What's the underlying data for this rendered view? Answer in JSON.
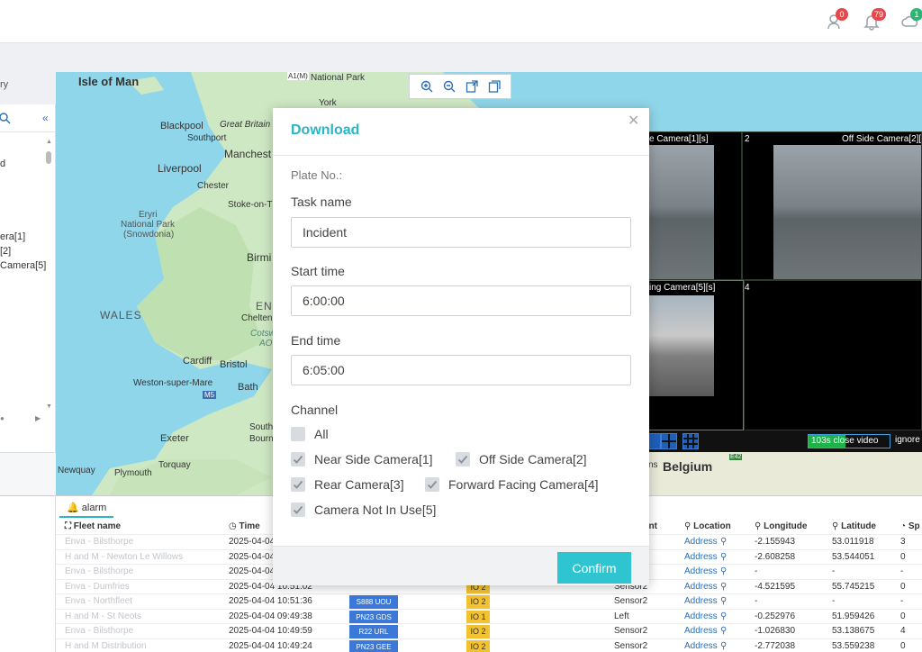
{
  "header": {
    "badges": [
      {
        "icon": "user-alert-icon",
        "count": "0"
      },
      {
        "icon": "bell-icon",
        "count": "79"
      },
      {
        "icon": "cloud-icon",
        "count": "1"
      }
    ]
  },
  "map": {
    "labels": {
      "isle_of_man": "Isle of Man",
      "national_park": "National Park",
      "york": "York",
      "blackpool": "Blackpool",
      "great_britain": "Great Britain",
      "southport": "Southport",
      "manchester": "Manchest",
      "liverpool": "Liverpool",
      "chester": "Chester",
      "stoke": "Stoke-on-T",
      "eryri": "Eryri",
      "eryri_np": "National Park",
      "snowdonia": "(Snowdonia)",
      "birmingham": "Birmi",
      "wales": "WALES",
      "eng": "ENG",
      "cheltenham": "Chelten",
      "cotswold": "Cotswo",
      "aonb": "AO",
      "cardiff": "Cardiff",
      "bristol": "Bristol",
      "weston": "Weston-super-Mare",
      "bath": "Bath",
      "m5": "M5",
      "south": "South",
      "exeter": "Exeter",
      "bourn": "Bourn",
      "newquay": "Newquay",
      "plymouth": "Plymouth",
      "torquay": "Torquay",
      "belgium": "Belgium",
      "ns": "ns",
      "e42": "E42",
      "a1m": "A1(M)"
    },
    "tools": [
      "zoom-in-icon",
      "zoom-out-icon",
      "export-icon",
      "copy-icon"
    ]
  },
  "left_panel": {
    "items": [
      "ry",
      "d",
      "era[1]",
      "[2]",
      "Camera[5]"
    ]
  },
  "videos": {
    "cells": [
      {
        "num": "",
        "title": "e Camera[1][s]"
      },
      {
        "num": "2",
        "title": "Off Side Camera[2][s"
      },
      {
        "num": "",
        "title": "ing Camera[5][s]"
      },
      {
        "num": "4",
        "title": ""
      }
    ],
    "close_video": "103s close video",
    "close_progress": 0.45,
    "ignore": "ignore"
  },
  "alarm": {
    "tab": "alarm",
    "columns": {
      "fleet": "Fleet name",
      "time": "Time",
      "event": "ent",
      "location": "Location",
      "longitude": "Longitude",
      "latitude": "Latitude",
      "speed": "Sp"
    },
    "rows": [
      {
        "fleet": "Enva - Bilsthorpe",
        "time": "2025-04-04",
        "plate": "",
        "io": "",
        "event": "",
        "location": "Address",
        "lon": "-2.155943",
        "lat": "53.011918",
        "spd": "3"
      },
      {
        "fleet": "H and M - Newton Le Willows",
        "time": "2025-04-04",
        "plate": "",
        "io": "",
        "event": "",
        "location": "Address",
        "lon": "-2.608258",
        "lat": "53.544051",
        "spd": "0"
      },
      {
        "fleet": "Enva - Bilsthorpe",
        "time": "2025-04-04",
        "plate": "",
        "io": "",
        "event": "",
        "location": "Address",
        "lon": "-",
        "lat": "-",
        "spd": "-"
      },
      {
        "fleet": "Enva - Dumfries",
        "time": "2025-04-04 10:51:02",
        "plate": "",
        "io": "IO 2",
        "event": "Sensor2",
        "location": "Address",
        "lon": "-4.521595",
        "lat": "55.745215",
        "spd": "0"
      },
      {
        "fleet": "Enva - Northfleet",
        "time": "2025-04-04 10:51:36",
        "plate": "S888 UOU",
        "io": "IO 2",
        "event": "Sensor2",
        "location": "Address",
        "lon": "-",
        "lat": "-",
        "spd": "-"
      },
      {
        "fleet": "H and M - St Neots",
        "time": "2025-04-04 09:49:38",
        "plate": "PN23 GDS",
        "io": "IO 1",
        "event": "Left",
        "location": "Address",
        "lon": "-0.252976",
        "lat": "51.959426",
        "spd": "0"
      },
      {
        "fleet": "Enva - Bilsthorpe",
        "time": "2025-04-04 10:49:59",
        "plate": "R22 URL",
        "io": "IO 2",
        "event": "Sensor2",
        "location": "Address",
        "lon": "-1.026830",
        "lat": "53.138675",
        "spd": "4"
      },
      {
        "fleet": "H and M Distribution",
        "time": "2025-04-04 10:49:24",
        "plate": "PN23 GEE",
        "io": "IO 2",
        "event": "Sensor2",
        "location": "Address",
        "lon": "-2.772038",
        "lat": "53.559238",
        "spd": "0"
      }
    ]
  },
  "modal": {
    "title": "Download",
    "plate_label": "Plate No.:",
    "task_label": "Task name",
    "task_value": "Incident",
    "start_label": "Start time",
    "start_value": "6:00:00",
    "end_label": "End time",
    "end_value": "6:05:00",
    "channel_label": "Channel",
    "channels": [
      {
        "label": "All",
        "checked": false
      },
      {
        "label": "Near Side Camera[1]",
        "checked": true
      },
      {
        "label": "Off Side Camera[2]",
        "checked": true
      },
      {
        "label": "Rear Camera[3]",
        "checked": true
      },
      {
        "label": "Forward Facing Camera[4]",
        "checked": true
      },
      {
        "label": "Camera Not In Use[5]",
        "checked": true
      }
    ],
    "confirm": "Confirm"
  }
}
